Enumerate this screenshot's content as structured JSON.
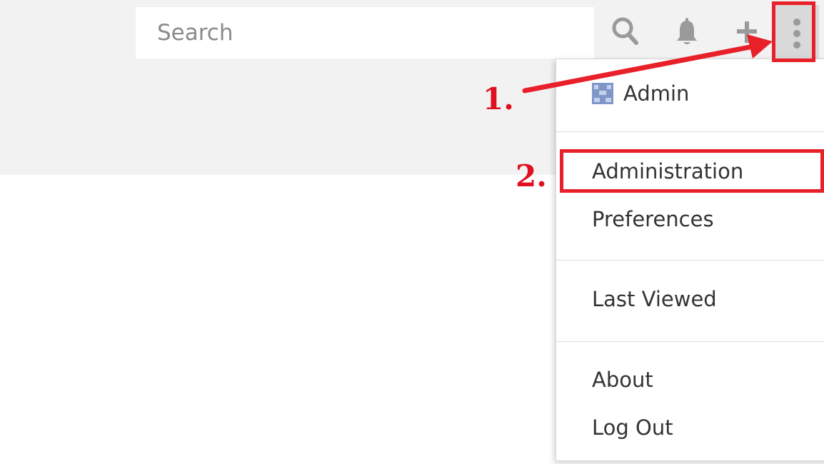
{
  "search": {
    "placeholder": "Search"
  },
  "toolbar": {
    "icons": [
      "search-icon",
      "bell-icon",
      "plus-icon",
      "more-vertical-icon"
    ]
  },
  "menu": {
    "user_name": "Admin",
    "items": [
      {
        "label": "Administration"
      },
      {
        "label": "Preferences"
      },
      {
        "label": "Last Viewed"
      },
      {
        "label": "About"
      },
      {
        "label": "Log Out"
      }
    ]
  },
  "annotations": {
    "step1": "1.",
    "step2": "2."
  },
  "colors": {
    "topbar_background": "#f2f2f2",
    "annotation_red": "#e8202a",
    "icon_gray": "#9a9a9a",
    "avatar_blue": "#7f96c8"
  }
}
